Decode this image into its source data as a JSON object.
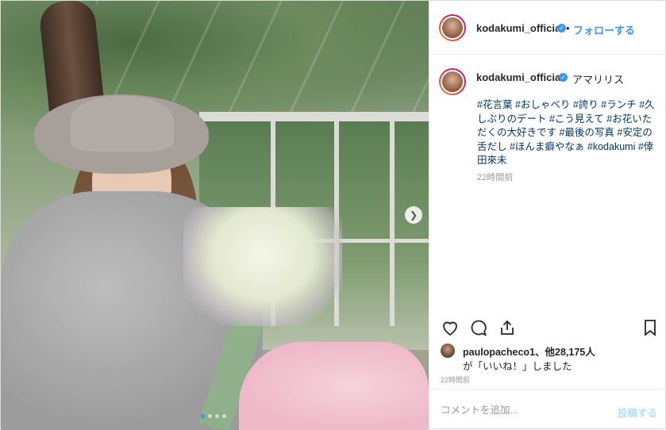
{
  "post": {
    "username": "kodakumi_official",
    "separator": "•",
    "follow_label": "フォローする",
    "verified_icon": "verified-badge-icon"
  },
  "caption": {
    "username": "kodakumi_official",
    "title": "アマリリス",
    "hashtags": "#花言葉 #おしゃべり #誇り #ランチ #久しぶりのデート #こう見えて #お花いただくの大好きです #最後の写真 #安定の舌だし #ほんま癖やなぁ #kodakumi #倖田來未",
    "time": "22時間前"
  },
  "likes": {
    "user": "paulopacheco1",
    "others": "、他28,175人",
    "suffix": "が「いいね！」しました"
  },
  "time_bottom": "22時間前",
  "comment": {
    "placeholder": "コメントを追加...",
    "post_label": "投稿する"
  },
  "carousel": {
    "total": 4,
    "active": 1
  },
  "colors": {
    "link": "#3897f0",
    "hashtag": "#003569",
    "muted": "#999999"
  }
}
